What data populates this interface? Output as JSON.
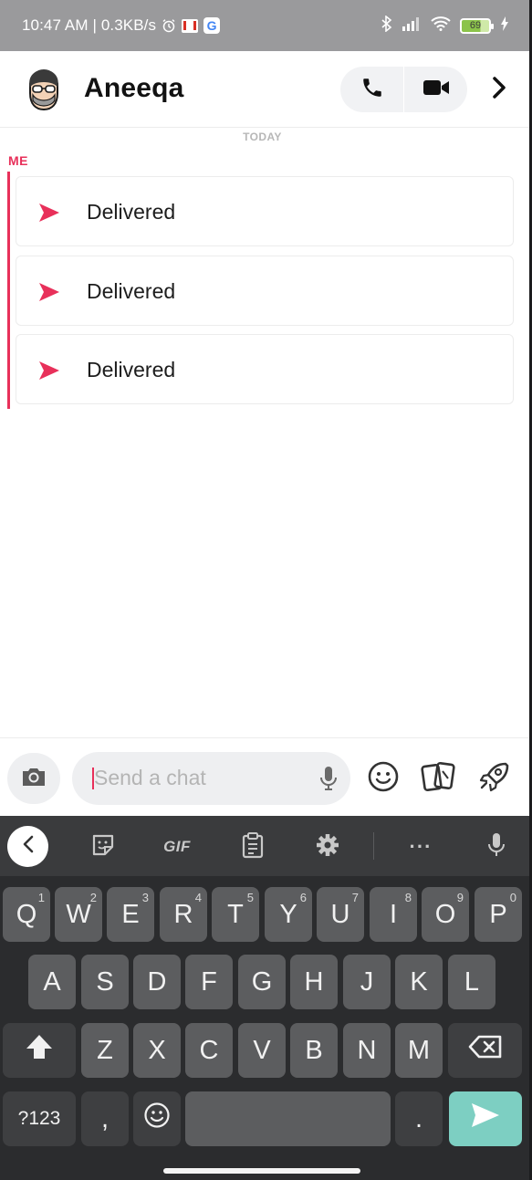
{
  "status_bar": {
    "time": "10:47 AM",
    "separator": "|",
    "speed": "0.3KB/s",
    "battery": "69",
    "icons": [
      "alarm-icon",
      "gmail-icon",
      "google-icon",
      "bluetooth-icon",
      "signal-icon",
      "wifi-icon",
      "battery-icon",
      "charging-icon"
    ]
  },
  "header": {
    "contact_name": "Aneeqa",
    "icons": [
      "avatar",
      "phone-icon",
      "video-icon",
      "chevron-right-icon"
    ]
  },
  "conversation": {
    "date_divider": "TODAY",
    "sender_label": "ME",
    "accent_color": "#e8305a",
    "messages": [
      {
        "status": "Delivered",
        "icon": "sent-arrow-icon"
      },
      {
        "status": "Delivered",
        "icon": "sent-arrow-icon"
      },
      {
        "status": "Delivered",
        "icon": "sent-arrow-icon"
      }
    ]
  },
  "chat_bar": {
    "placeholder": "Send a chat",
    "icons": [
      "camera-icon",
      "microphone-icon",
      "emoji-icon",
      "cards-icon",
      "rocket-icon"
    ]
  },
  "keyboard": {
    "toolbar": {
      "gif_label": "GIF",
      "more_label": "···",
      "icons": [
        "back-icon",
        "sticker-icon",
        "clipboard-icon",
        "settings-icon",
        "microphone-icon"
      ]
    },
    "row1": [
      {
        "k": "Q",
        "n": "1"
      },
      {
        "k": "W",
        "n": "2"
      },
      {
        "k": "E",
        "n": "3"
      },
      {
        "k": "R",
        "n": "4"
      },
      {
        "k": "T",
        "n": "5"
      },
      {
        "k": "Y",
        "n": "6"
      },
      {
        "k": "U",
        "n": "7"
      },
      {
        "k": "I",
        "n": "8"
      },
      {
        "k": "O",
        "n": "9"
      },
      {
        "k": "P",
        "n": "0"
      }
    ],
    "row2": [
      "A",
      "S",
      "D",
      "F",
      "G",
      "H",
      "J",
      "K",
      "L"
    ],
    "row3": [
      "Z",
      "X",
      "C",
      "V",
      "B",
      "N",
      "M"
    ],
    "symbols_label": "?123",
    "comma_label": ",",
    "period_label": ".",
    "send_color": "#7dcfc2"
  }
}
